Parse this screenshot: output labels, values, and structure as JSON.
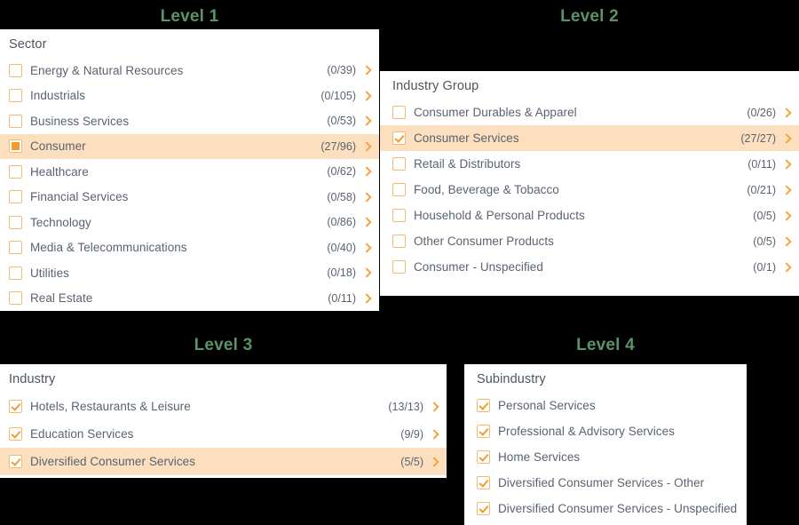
{
  "accent_color": "#f59b2e",
  "selected_row_color": "#fbdfbe",
  "title_color": "#5a9367",
  "levels": [
    {
      "title": "Level 1",
      "header": "Sector",
      "rows": [
        {
          "label": "Energy & Natural Resources",
          "count": "(0/39)",
          "state": "unchecked",
          "selected": false,
          "chevron": true
        },
        {
          "label": "Industrials",
          "count": "(0/105)",
          "state": "unchecked",
          "selected": false,
          "chevron": true
        },
        {
          "label": "Business Services",
          "count": "(0/53)",
          "state": "unchecked",
          "selected": false,
          "chevron": true
        },
        {
          "label": "Consumer",
          "count": "(27/96)",
          "state": "indeterminate",
          "selected": true,
          "chevron": true
        },
        {
          "label": "Healthcare",
          "count": "(0/62)",
          "state": "unchecked",
          "selected": false,
          "chevron": true
        },
        {
          "label": "Financial Services",
          "count": "(0/58)",
          "state": "unchecked",
          "selected": false,
          "chevron": true
        },
        {
          "label": "Technology",
          "count": "(0/86)",
          "state": "unchecked",
          "selected": false,
          "chevron": true
        },
        {
          "label": "Media & Telecommunications",
          "count": "(0/40)",
          "state": "unchecked",
          "selected": false,
          "chevron": true
        },
        {
          "label": "Utilities",
          "count": "(0/18)",
          "state": "unchecked",
          "selected": false,
          "chevron": true
        },
        {
          "label": "Real Estate",
          "count": "(0/11)",
          "state": "unchecked",
          "selected": false,
          "chevron": true
        }
      ]
    },
    {
      "title": "Level 2",
      "header": "Industry Group",
      "rows": [
        {
          "label": "Consumer Durables & Apparel",
          "count": "(0/26)",
          "state": "unchecked",
          "selected": false,
          "chevron": true
        },
        {
          "label": "Consumer Services",
          "count": "(27/27)",
          "state": "checked",
          "selected": true,
          "chevron": true
        },
        {
          "label": "Retail & Distributors",
          "count": "(0/11)",
          "state": "unchecked",
          "selected": false,
          "chevron": true
        },
        {
          "label": "Food, Beverage & Tobacco",
          "count": "(0/21)",
          "state": "unchecked",
          "selected": false,
          "chevron": true
        },
        {
          "label": "Household & Personal Products",
          "count": "(0/5)",
          "state": "unchecked",
          "selected": false,
          "chevron": true
        },
        {
          "label": "Other Consumer Products",
          "count": "(0/5)",
          "state": "unchecked",
          "selected": false,
          "chevron": true
        },
        {
          "label": "Consumer - Unspecified",
          "count": "(0/1)",
          "state": "unchecked",
          "selected": false,
          "chevron": true
        }
      ]
    },
    {
      "title": "Level 3",
      "header": "Industry",
      "rows": [
        {
          "label": "Hotels, Restaurants & Leisure",
          "count": "(13/13)",
          "state": "checked",
          "selected": false,
          "chevron": true
        },
        {
          "label": "Education Services",
          "count": "(9/9)",
          "state": "checked",
          "selected": false,
          "chevron": true
        },
        {
          "label": "Diversified Consumer Services",
          "count": "(5/5)",
          "state": "checked",
          "selected": true,
          "chevron": true
        }
      ]
    },
    {
      "title": "Level 4",
      "header": "Subindustry",
      "rows": [
        {
          "label": "Personal Services",
          "count": "",
          "state": "checked",
          "selected": false,
          "chevron": false
        },
        {
          "label": "Professional & Advisory Services",
          "count": "",
          "state": "checked",
          "selected": false,
          "chevron": false
        },
        {
          "label": "Home Services",
          "count": "",
          "state": "checked",
          "selected": false,
          "chevron": false
        },
        {
          "label": "Diversified Consumer Services - Other",
          "count": "",
          "state": "checked",
          "selected": false,
          "chevron": false
        },
        {
          "label": "Diversified Consumer Services - Unspecified",
          "count": "",
          "state": "checked",
          "selected": false,
          "chevron": false
        }
      ]
    }
  ]
}
